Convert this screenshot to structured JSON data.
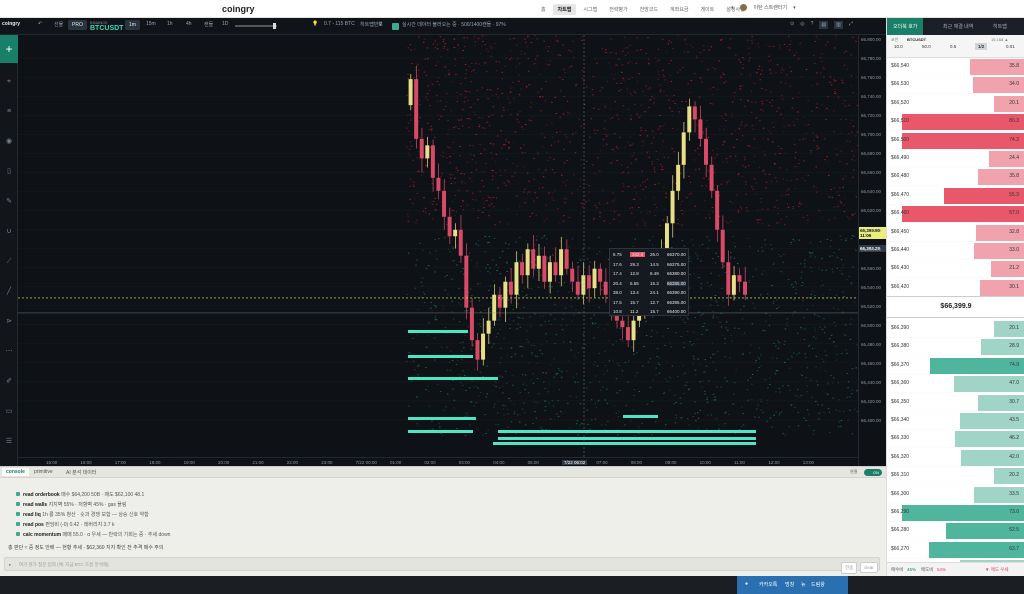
{
  "topbar": {
    "brand": "coingry",
    "nav": [
      "홈",
      "차트맵",
      "시그맵",
      "전략평가",
      "전망코드",
      "계좌요금",
      "게이트",
      "설정사항"
    ],
    "active_index": 1,
    "user_label": "이탄 스트랜터기"
  },
  "toolbar": {
    "logo": "coingry",
    "label_a": "선물",
    "pro_label": "PRO",
    "exchange": "BINANCE",
    "symbol": "BTCUSDT",
    "timeframes": [
      "1m",
      "15m",
      "1h",
      "4h"
    ],
    "active_tf_index": 0,
    "indicator_label": "캔들",
    "type_label": "1D",
    "price_chip": "0.7 - 115 BTC",
    "heat_label": "히트맵빈도",
    "status_text": "실시간 데이터 불러오는 중 · 500/1400캔들 · 97%"
  },
  "chart": {
    "y_ticks": [
      "66,800.00",
      "66,780.00",
      "66,760.00",
      "66,740.00",
      "66,720.00",
      "66,700.00",
      "66,680.00",
      "66,660.00",
      "66,640.00",
      "66,620.00",
      "66,600.00",
      "66,580.00",
      "66,560.00",
      "66,540.00",
      "66,520.00",
      "66,500.00",
      "66,480.00",
      "66,460.00",
      "66,440.00",
      "66,420.00",
      "66,400.00"
    ],
    "x_ticks": [
      "15:00",
      "16:00",
      "17:00",
      "18:00",
      "19:00",
      "20:00",
      "21:00",
      "22:00",
      "23:00",
      "7/22 00:00",
      "01:00",
      "02:00",
      "03:00",
      "04:00",
      "05:00",
      "7/22 06:02",
      "07:00",
      "08:00",
      "09:00",
      "10:00",
      "11:00",
      "12:00",
      "13:00"
    ],
    "price_tag": "66,399.90",
    "price_tag_sub": "11:06",
    "cursor_tag": "66,393.29",
    "colors": {
      "bull": "#e8df86",
      "bear": "#d94a67",
      "heat_hi": "#d6202c",
      "heat_lo": "#1f7a5f",
      "wall": "#4ee5c3"
    }
  },
  "chart_data": {
    "type": "candlestick",
    "title": "",
    "x": [
      "01:05",
      "01:15",
      "01:25",
      "01:35",
      "01:45",
      "01:55",
      "02:05",
      "02:15",
      "02:25",
      "02:35",
      "02:45",
      "02:55",
      "03:05",
      "03:15",
      "03:25",
      "03:35",
      "03:45",
      "03:55",
      "04:05",
      "04:15",
      "04:25",
      "04:35",
      "04:45",
      "04:55",
      "05:05",
      "05:15",
      "05:25",
      "05:35",
      "05:45",
      "05:55",
      "06:05",
      "06:15",
      "06:25",
      "06:35",
      "06:45",
      "06:55",
      "07:05",
      "07:15",
      "07:25",
      "07:35",
      "07:45",
      "07:55",
      "08:05",
      "08:15",
      "08:25",
      "08:35",
      "08:45",
      "08:55",
      "09:05",
      "09:15",
      "09:25",
      "09:35",
      "09:45",
      "09:55",
      "10:05",
      "10:15",
      "10:25",
      "10:35",
      "10:45",
      "10:55",
      "11:05"
    ],
    "close": [
      66732,
      66640,
      66610,
      66630,
      66580,
      66560,
      66520,
      66490,
      66500,
      66460,
      66380,
      66330,
      66300,
      66340,
      66360,
      66400,
      66380,
      66420,
      66400,
      66450,
      66430,
      66470,
      66440,
      66460,
      66420,
      66450,
      66430,
      66470,
      66440,
      66420,
      66400,
      66430,
      66410,
      66440,
      66420,
      66400,
      66380,
      66360,
      66350,
      66330,
      66360,
      66380,
      66400,
      66410,
      66430,
      66470,
      66510,
      66560,
      66600,
      66650,
      66690,
      66670,
      66640,
      66600,
      66560,
      66500,
      66450,
      66400,
      66430,
      66420,
      66400
    ],
    "ylim": [
      66150,
      66800
    ],
    "orderbook_popup": [
      [
        "6.75",
        "342.0",
        "26.0",
        "66370.00"
      ],
      [
        "17.6",
        "29.3",
        "14.5",
        "66375.00"
      ],
      [
        "17.4",
        "12.8",
        "8.49",
        "66380.00"
      ],
      [
        "20.4",
        "5.55",
        "15.3",
        "66385.00"
      ],
      [
        "38.0",
        "13.4",
        "24.1",
        "66390.00"
      ],
      [
        "17.5",
        "15.7",
        "12.7",
        "66395.00"
      ],
      [
        "10.8",
        "11.2",
        "15.7",
        "66400.00"
      ]
    ]
  },
  "console": {
    "tabs": [
      "console",
      "primitive",
      "AI 분석 데이터"
    ],
    "toggle": "ON",
    "scroll_label": "연결",
    "lines": [
      {
        "cmd": "read",
        "name": "orderbook",
        "text": "매수 $64,200 50B · 매도 $62,100 48.1"
      },
      {
        "cmd": "read",
        "name": "walls",
        "text": "지지벽 55% · 저항벽 45% · gas 플링"
      },
      {
        "cmd": "read",
        "name": "liq",
        "text": "1h 롱 35% 청산 · 숏과 경쟁 보합 — 상승 신호 약함"
      },
      {
        "cmd": "read",
        "name": "pos",
        "text": "펀딩비 (-0) 0.42 · 레버리지 3.7 k"
      },
      {
        "cmd": "calc",
        "name": "momentum",
        "text": "매매 55.0 · α 우세 — 반락의 기회는 중 · 추세 down"
      }
    ],
    "summary": "총 판단 ≈ 중 정도 안배 — 현황 추세 · $62,360 지지 확인 전 추격 매수 주의",
    "input_placeholder": "여기 뭔가 질문 입력 (예: 지금 BTC 흐름 분석해)",
    "send_label": "전송",
    "clear_label": "clear"
  },
  "orderbook": {
    "tabs": [
      "오더북 호가",
      "최근 체결 내역",
      "히트맵"
    ],
    "symbol_label": "코인",
    "symbol": "BTCUSDT",
    "size_hint": "15,168 ▲",
    "scales": [
      "10.0",
      "50.0",
      "0.5",
      "1/2",
      "0.01"
    ],
    "active_scale": 3,
    "asks": [
      {
        "p": "$66,540",
        "s": "35.8",
        "w": 0.42
      },
      {
        "p": "$66,530",
        "s": "34.0",
        "w": 0.4
      },
      {
        "p": "$66,520",
        "s": "20.1",
        "w": 0.24
      },
      {
        "p": "$66,510",
        "s": "80.3",
        "w": 0.95
      },
      {
        "p": "$66,500",
        "s": "74.3",
        "w": 0.95
      },
      {
        "p": "$66,490",
        "s": "24.4",
        "w": 0.28
      },
      {
        "p": "$66,480",
        "s": "35.8",
        "w": 0.36
      },
      {
        "p": "$66,470",
        "s": "55.3",
        "w": 0.62
      },
      {
        "p": "$66,460",
        "s": "57.0",
        "w": 0.95
      },
      {
        "p": "$66,450",
        "s": "32.8",
        "w": 0.38
      },
      {
        "p": "$66,440",
        "s": "33.0",
        "w": 0.39
      },
      {
        "p": "$66,430",
        "s": "21.2",
        "w": 0.26
      },
      {
        "p": "$66,420",
        "s": "30.1",
        "w": 0.35
      },
      {
        "p": "$66,410",
        "s": "35.5",
        "w": 0.41
      }
    ],
    "mid_price": "$66,399.9",
    "bids": [
      {
        "p": "$66,390",
        "s": "20.1",
        "w": 0.24
      },
      {
        "p": "$66,380",
        "s": "28.9",
        "w": 0.34
      },
      {
        "p": "$66,370",
        "s": "74.9",
        "w": 0.73
      },
      {
        "p": "$66,360",
        "s": "47.0",
        "w": 0.55
      },
      {
        "p": "$66,350",
        "s": "30.7",
        "w": 0.36
      },
      {
        "p": "$66,340",
        "s": "43.5",
        "w": 0.5
      },
      {
        "p": "$66,330",
        "s": "46.2",
        "w": 0.54
      },
      {
        "p": "$66,320",
        "s": "42.0",
        "w": 0.49
      },
      {
        "p": "$66,310",
        "s": "20.2",
        "w": 0.24
      },
      {
        "p": "$66,300",
        "s": "33.5",
        "w": 0.39
      },
      {
        "p": "$66,290",
        "s": "73.0",
        "w": 0.95
      },
      {
        "p": "$66,280",
        "s": "52.5",
        "w": 0.61
      },
      {
        "p": "$66,270",
        "s": "63.7",
        "w": 0.74
      },
      {
        "p": "$66,260",
        "s": "43.1",
        "w": 0.5
      }
    ],
    "footer": {
      "buy_label": "매수비",
      "buy_val": "46%",
      "sell_label": "매도비",
      "sell_val": "54%",
      "signal": "▼ 매도 우세"
    },
    "colors": {
      "ask": "#f0a3ac",
      "ask_strong": "#e8576a",
      "bid": "#9fd4c6",
      "bid_strong": "#4fb59c"
    }
  },
  "taskbar": {
    "items": [
      "카카오톡",
      "멍칭",
      "뉴",
      "드림왕"
    ]
  }
}
